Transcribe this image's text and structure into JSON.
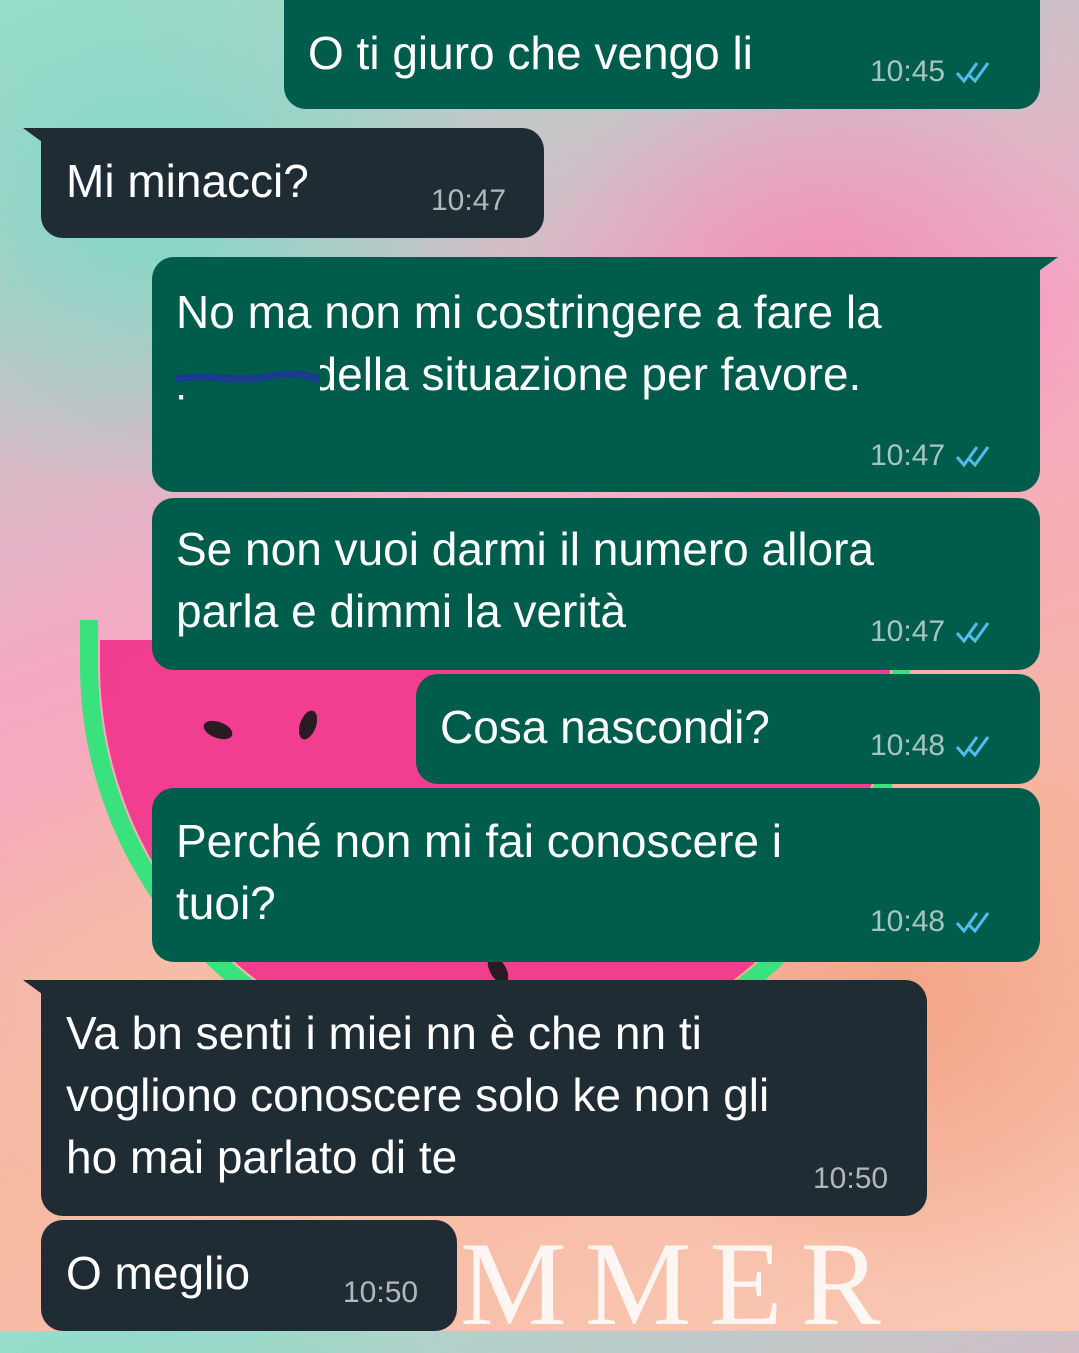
{
  "theme": {
    "outgoing_bubble": "#005c4b",
    "incoming_bubble": "#202c33",
    "read_tick": "#53bdeb"
  },
  "wallpaper": {
    "text": "MMER"
  },
  "messages": [
    {
      "direction": "outgoing",
      "lines": [
        "O ti giuro che vengo li"
      ],
      "time": "10:45",
      "status": "read",
      "status_icon": "double-check-icon"
    },
    {
      "direction": "incoming",
      "lines": [
        "Mi minacci?"
      ],
      "time": "10:47"
    },
    {
      "direction": "outgoing",
      "lines": [
        "No ma non mi costringere a fare la",
        "pazza della situazione per favore."
      ],
      "struck_word": "pazza",
      "time": "10:47",
      "status": "read",
      "status_icon": "double-check-icon"
    },
    {
      "direction": "outgoing",
      "lines": [
        "Se non vuoi darmi il numero allora",
        "parla e dimmi la verità"
      ],
      "time": "10:47",
      "status": "read",
      "status_icon": "double-check-icon"
    },
    {
      "direction": "outgoing",
      "lines": [
        "Cosa nascondi?"
      ],
      "time": "10:48",
      "status": "read",
      "status_icon": "double-check-icon"
    },
    {
      "direction": "outgoing",
      "lines": [
        "Perché non mi fai conoscere i",
        "tuoi?"
      ],
      "time": "10:48",
      "status": "read",
      "status_icon": "double-check-icon"
    },
    {
      "direction": "incoming",
      "lines": [
        "Va bn senti i miei nn è che nn ti",
        "vogliono conoscere solo ke non gli",
        "ho mai parlato di te"
      ],
      "time": "10:50"
    },
    {
      "direction": "incoming",
      "lines": [
        "O meglio"
      ],
      "time": "10:50"
    }
  ]
}
